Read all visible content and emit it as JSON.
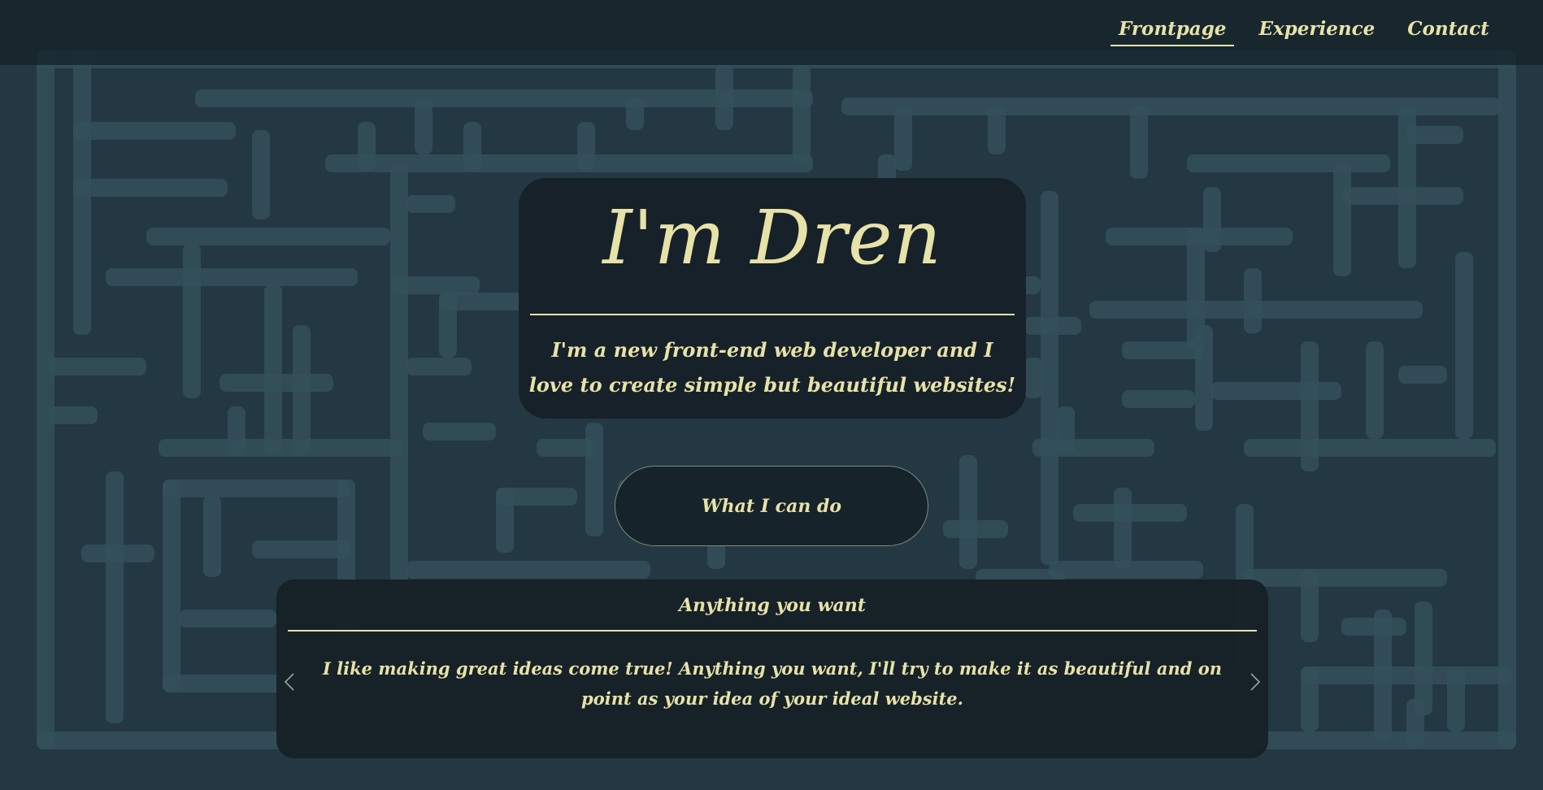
{
  "nav": {
    "items": [
      {
        "label": "Frontpage",
        "active": true
      },
      {
        "label": "Experience",
        "active": false
      },
      {
        "label": "Contact",
        "active": false
      }
    ]
  },
  "hero": {
    "title": "I'm Dren",
    "subtitle": "I'm a new front-end web developer and I love to create simple but beautiful websites!"
  },
  "cta": {
    "label": "What I can do"
  },
  "carousel": {
    "title": "Anything you want",
    "text": "I like making great ideas come true! Anything you want, I'll try to make it as beautiful and on point as your idea of your ideal website.",
    "prev_icon": "chevron-left-icon",
    "next_icon": "chevron-right-icon"
  },
  "colors": {
    "background": "#233842",
    "maze_wall": "#34505b",
    "card": "#162027",
    "accent_text": "#e6e2a8"
  }
}
